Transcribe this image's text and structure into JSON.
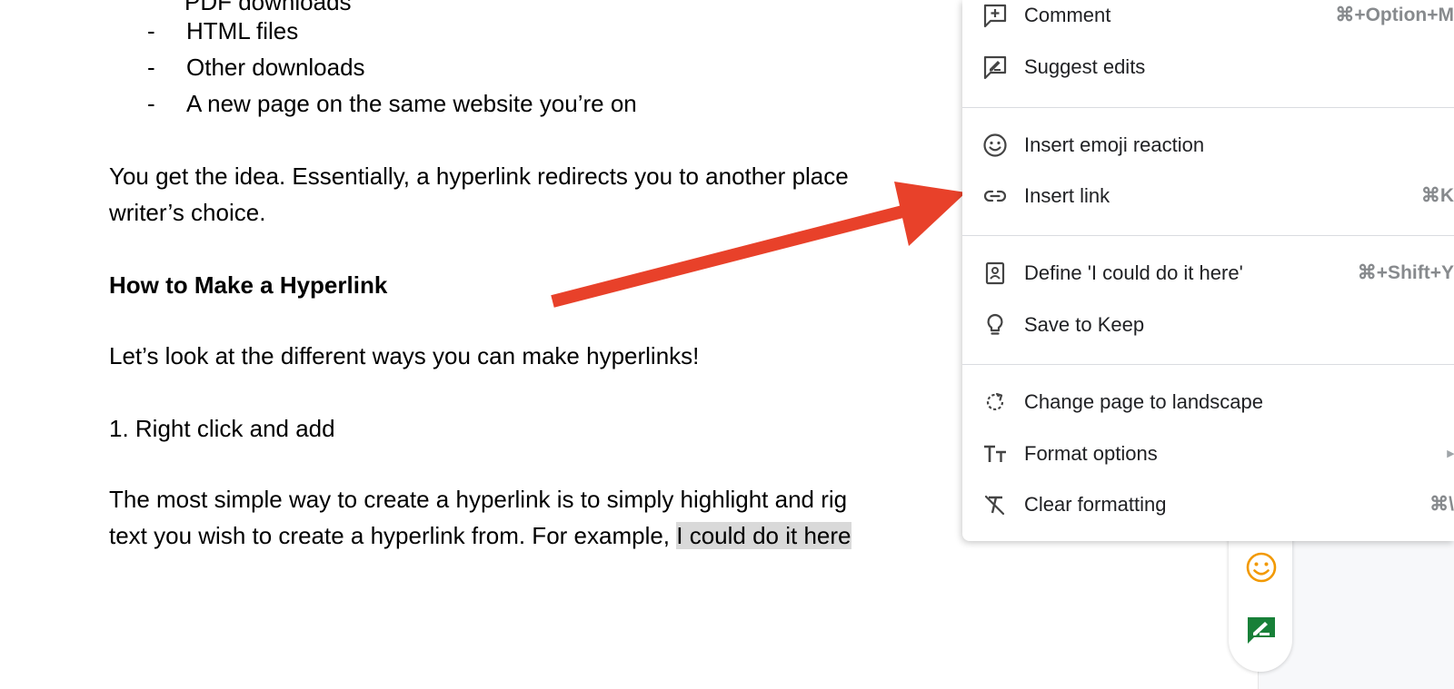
{
  "document": {
    "partial_top_text": "PDF downloads",
    "bullets": [
      {
        "dash": "-",
        "text": "HTML files"
      },
      {
        "dash": "-",
        "text": "Other downloads"
      },
      {
        "dash": "-",
        "text": "A new page on the same website you’re on"
      }
    ],
    "para1_line1": "You get the idea. Essentially, a hyperlink redirects you to another place",
    "para1_line2": "writer’s choice.",
    "heading": "How to Make a Hyperlink",
    "para2": "Let’s look at the different ways you can make hyperlinks!",
    "step1": "1. Right click and add",
    "para3_line1": "The most simple way to create a hyperlink is to simply highlight and rig",
    "para3_line2_prefix": "text you wish to create a hyperlink from. For example, ",
    "para3_line2_highlight": "I could do it here"
  },
  "context_menu": {
    "items": [
      {
        "icon": "add-comment-icon",
        "label": "Comment",
        "shortcut": "⌘+Option+M"
      },
      {
        "icon": "suggest-edits-icon",
        "label": "Suggest edits",
        "shortcut": ""
      },
      {
        "icon": "emoji-icon",
        "label": "Insert emoji reaction",
        "shortcut": ""
      },
      {
        "icon": "link-icon",
        "label": "Insert link",
        "shortcut": "⌘K"
      },
      {
        "icon": "dictionary-icon",
        "label": "Define 'I could do it here'",
        "shortcut": "⌘+Shift+Y"
      },
      {
        "icon": "lightbulb-icon",
        "label": "Save to Keep",
        "shortcut": ""
      },
      {
        "icon": "rotate-page-icon",
        "label": "Change page to landscape",
        "shortcut": ""
      },
      {
        "icon": "text-size-icon",
        "label": "Format options",
        "shortcut": "▸"
      },
      {
        "icon": "clear-formatting-icon",
        "label": "Clear formatting",
        "shortcut": "⌘\\"
      }
    ]
  },
  "side_actions": {
    "emoji_button_color": "#f29900",
    "suggest_button_color": "#188038"
  },
  "annotation": {
    "arrow_color": "#e8412a"
  }
}
